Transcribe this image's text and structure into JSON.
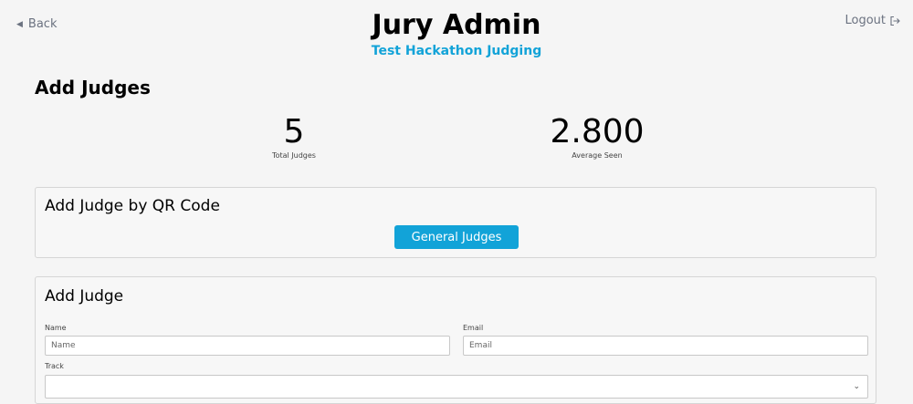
{
  "nav": {
    "back_label": "Back",
    "logout_label": "Logout"
  },
  "header": {
    "title": "Jury Admin",
    "subtitle": "Test Hackathon Judging"
  },
  "page": {
    "title": "Add Judges"
  },
  "stats": [
    {
      "value": "5",
      "label": "Total Judges"
    },
    {
      "value": "2.800",
      "label": "Average Seen"
    }
  ],
  "qr_card": {
    "title": "Add Judge by QR Code",
    "button_label": "General Judges"
  },
  "add_card": {
    "title": "Add Judge",
    "name_label": "Name",
    "name_placeholder": "Name",
    "email_label": "Email",
    "email_placeholder": "Email",
    "track_label": "Track",
    "track_value": ""
  },
  "colors": {
    "accent": "#12a3d8",
    "background": "#f5f5f5"
  }
}
